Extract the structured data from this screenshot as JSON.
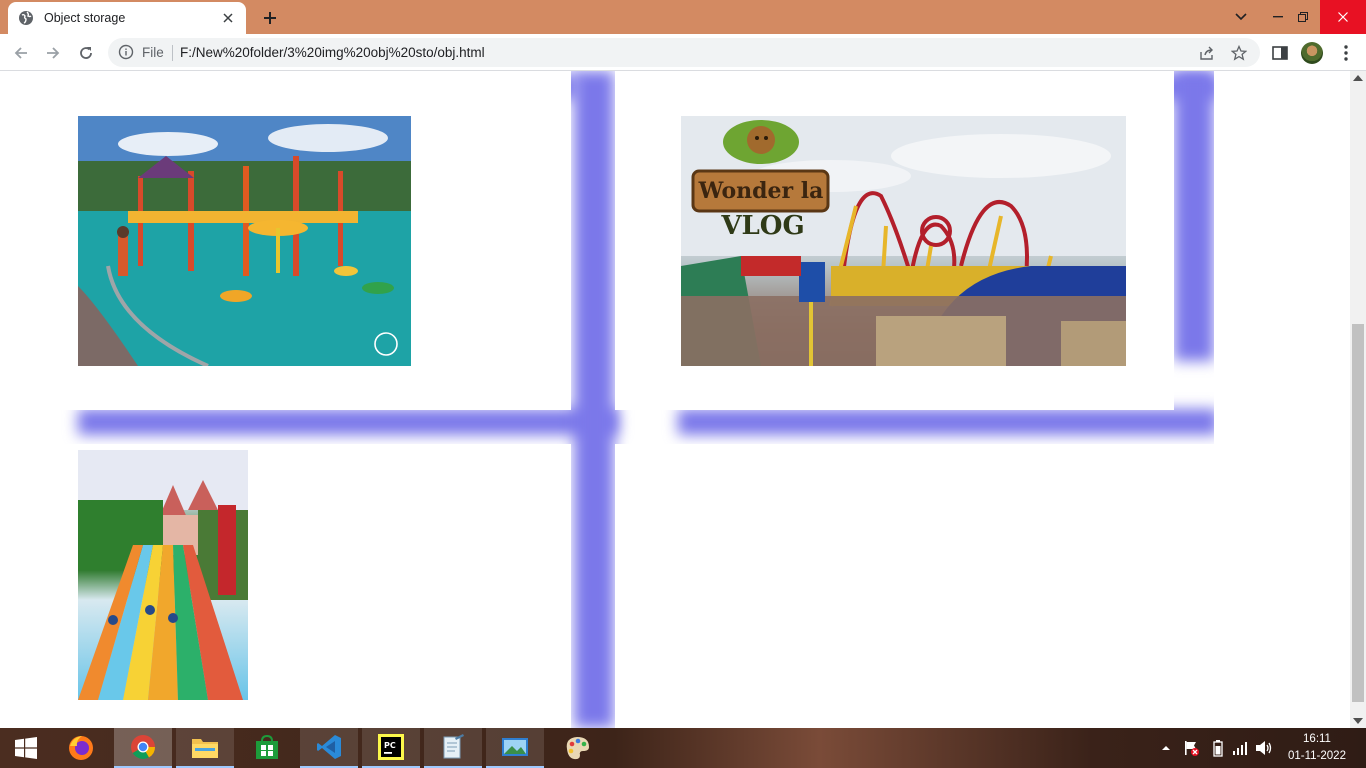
{
  "browser": {
    "tab": {
      "title": "Object storage"
    },
    "omnibox": {
      "scheme": "File",
      "url": "F:/New%20folder/3%20img%20obj%20sto/obj.html"
    }
  },
  "page": {
    "images": [
      {
        "name": "water-park-image",
        "description": ""
      },
      {
        "name": "wonderla-vlog-image",
        "overlay_line1": "Wonder la",
        "overlay_line2": "VLOG"
      },
      {
        "name": "water-slides-image"
      }
    ],
    "accent_color": "#7b78ea"
  },
  "taskbar": {
    "apps": [
      "start-icon",
      "firefox-icon",
      "chrome-icon",
      "file-explorer-icon",
      "store-icon",
      "vscode-icon",
      "pycharm-icon",
      "notepad-icon",
      "photos-icon",
      "paint-icon"
    ],
    "clock": {
      "time": "16:11",
      "date": "01-11-2022"
    }
  }
}
